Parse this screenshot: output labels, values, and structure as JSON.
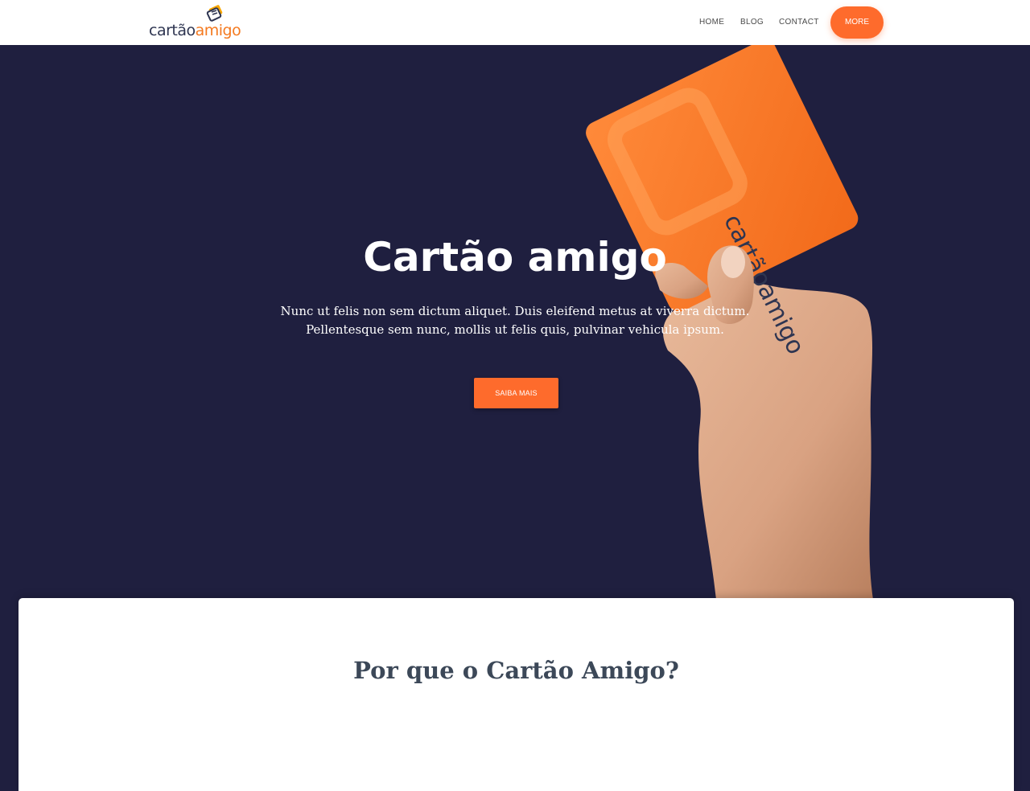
{
  "header": {
    "logo": {
      "text_dark": "cartão",
      "text_accent": "amigo"
    },
    "nav": {
      "home": "HOME",
      "blog": "BLOG",
      "contact": "CONTACT",
      "more": "MORE"
    }
  },
  "hero": {
    "title": "Cartão amigo",
    "subtitle_line1": "Nunc ut felis non sem dictum aliquet. Duis eleifend metus at viverra dictum.",
    "subtitle_line2": "Pellentesque sem nunc, mollis ut felis quis, pulvinar vehicula ipsum.",
    "button": "SAIBA MAIS",
    "card_brand": "cartãoamigo"
  },
  "section": {
    "title": "Por que o Cartão Amigo?"
  },
  "colors": {
    "accent": "#fe6b2c",
    "hero_background": "#1f1f3f",
    "heading_dark": "#3c4858"
  },
  "icons": [
    "logo-mark-icon",
    "hand-holding-card-image"
  ]
}
